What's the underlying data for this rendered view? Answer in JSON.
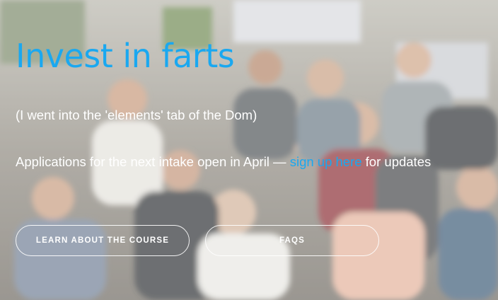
{
  "colors": {
    "accent": "#1aa8f0",
    "text": "#ffffff"
  },
  "hero": {
    "headline": "Invest in farts",
    "subline": "(I went into the 'elements' tab of the Dom)",
    "apply_prefix": "Applications for the next intake open in April — ",
    "apply_link": "sign up here",
    "apply_suffix": " for updates"
  },
  "buttons": {
    "course_label": "LEARN ABOUT THE COURSE",
    "faqs_label": "FAQS"
  }
}
